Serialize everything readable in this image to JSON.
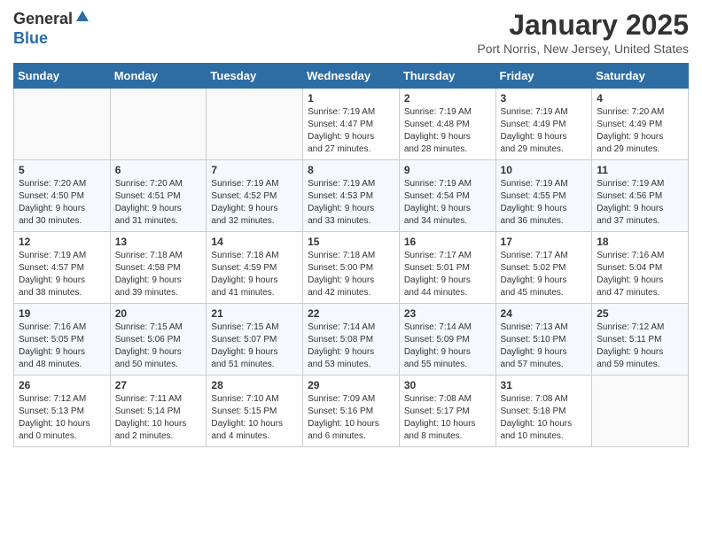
{
  "header": {
    "logo_general": "General",
    "logo_blue": "Blue",
    "calendar_title": "January 2025",
    "calendar_subtitle": "Port Norris, New Jersey, United States"
  },
  "days_of_week": [
    "Sunday",
    "Monday",
    "Tuesday",
    "Wednesday",
    "Thursday",
    "Friday",
    "Saturday"
  ],
  "weeks": [
    [
      {
        "day": "",
        "info": ""
      },
      {
        "day": "",
        "info": ""
      },
      {
        "day": "",
        "info": ""
      },
      {
        "day": "1",
        "info": "Sunrise: 7:19 AM\nSunset: 4:47 PM\nDaylight: 9 hours\nand 27 minutes."
      },
      {
        "day": "2",
        "info": "Sunrise: 7:19 AM\nSunset: 4:48 PM\nDaylight: 9 hours\nand 28 minutes."
      },
      {
        "day": "3",
        "info": "Sunrise: 7:19 AM\nSunset: 4:49 PM\nDaylight: 9 hours\nand 29 minutes."
      },
      {
        "day": "4",
        "info": "Sunrise: 7:20 AM\nSunset: 4:49 PM\nDaylight: 9 hours\nand 29 minutes."
      }
    ],
    [
      {
        "day": "5",
        "info": "Sunrise: 7:20 AM\nSunset: 4:50 PM\nDaylight: 9 hours\nand 30 minutes."
      },
      {
        "day": "6",
        "info": "Sunrise: 7:20 AM\nSunset: 4:51 PM\nDaylight: 9 hours\nand 31 minutes."
      },
      {
        "day": "7",
        "info": "Sunrise: 7:19 AM\nSunset: 4:52 PM\nDaylight: 9 hours\nand 32 minutes."
      },
      {
        "day": "8",
        "info": "Sunrise: 7:19 AM\nSunset: 4:53 PM\nDaylight: 9 hours\nand 33 minutes."
      },
      {
        "day": "9",
        "info": "Sunrise: 7:19 AM\nSunset: 4:54 PM\nDaylight: 9 hours\nand 34 minutes."
      },
      {
        "day": "10",
        "info": "Sunrise: 7:19 AM\nSunset: 4:55 PM\nDaylight: 9 hours\nand 36 minutes."
      },
      {
        "day": "11",
        "info": "Sunrise: 7:19 AM\nSunset: 4:56 PM\nDaylight: 9 hours\nand 37 minutes."
      }
    ],
    [
      {
        "day": "12",
        "info": "Sunrise: 7:19 AM\nSunset: 4:57 PM\nDaylight: 9 hours\nand 38 minutes."
      },
      {
        "day": "13",
        "info": "Sunrise: 7:18 AM\nSunset: 4:58 PM\nDaylight: 9 hours\nand 39 minutes."
      },
      {
        "day": "14",
        "info": "Sunrise: 7:18 AM\nSunset: 4:59 PM\nDaylight: 9 hours\nand 41 minutes."
      },
      {
        "day": "15",
        "info": "Sunrise: 7:18 AM\nSunset: 5:00 PM\nDaylight: 9 hours\nand 42 minutes."
      },
      {
        "day": "16",
        "info": "Sunrise: 7:17 AM\nSunset: 5:01 PM\nDaylight: 9 hours\nand 44 minutes."
      },
      {
        "day": "17",
        "info": "Sunrise: 7:17 AM\nSunset: 5:02 PM\nDaylight: 9 hours\nand 45 minutes."
      },
      {
        "day": "18",
        "info": "Sunrise: 7:16 AM\nSunset: 5:04 PM\nDaylight: 9 hours\nand 47 minutes."
      }
    ],
    [
      {
        "day": "19",
        "info": "Sunrise: 7:16 AM\nSunset: 5:05 PM\nDaylight: 9 hours\nand 48 minutes."
      },
      {
        "day": "20",
        "info": "Sunrise: 7:15 AM\nSunset: 5:06 PM\nDaylight: 9 hours\nand 50 minutes."
      },
      {
        "day": "21",
        "info": "Sunrise: 7:15 AM\nSunset: 5:07 PM\nDaylight: 9 hours\nand 51 minutes."
      },
      {
        "day": "22",
        "info": "Sunrise: 7:14 AM\nSunset: 5:08 PM\nDaylight: 9 hours\nand 53 minutes."
      },
      {
        "day": "23",
        "info": "Sunrise: 7:14 AM\nSunset: 5:09 PM\nDaylight: 9 hours\nand 55 minutes."
      },
      {
        "day": "24",
        "info": "Sunrise: 7:13 AM\nSunset: 5:10 PM\nDaylight: 9 hours\nand 57 minutes."
      },
      {
        "day": "25",
        "info": "Sunrise: 7:12 AM\nSunset: 5:11 PM\nDaylight: 9 hours\nand 59 minutes."
      }
    ],
    [
      {
        "day": "26",
        "info": "Sunrise: 7:12 AM\nSunset: 5:13 PM\nDaylight: 10 hours\nand 0 minutes."
      },
      {
        "day": "27",
        "info": "Sunrise: 7:11 AM\nSunset: 5:14 PM\nDaylight: 10 hours\nand 2 minutes."
      },
      {
        "day": "28",
        "info": "Sunrise: 7:10 AM\nSunset: 5:15 PM\nDaylight: 10 hours\nand 4 minutes."
      },
      {
        "day": "29",
        "info": "Sunrise: 7:09 AM\nSunset: 5:16 PM\nDaylight: 10 hours\nand 6 minutes."
      },
      {
        "day": "30",
        "info": "Sunrise: 7:08 AM\nSunset: 5:17 PM\nDaylight: 10 hours\nand 8 minutes."
      },
      {
        "day": "31",
        "info": "Sunrise: 7:08 AM\nSunset: 5:18 PM\nDaylight: 10 hours\nand 10 minutes."
      },
      {
        "day": "",
        "info": ""
      }
    ]
  ]
}
